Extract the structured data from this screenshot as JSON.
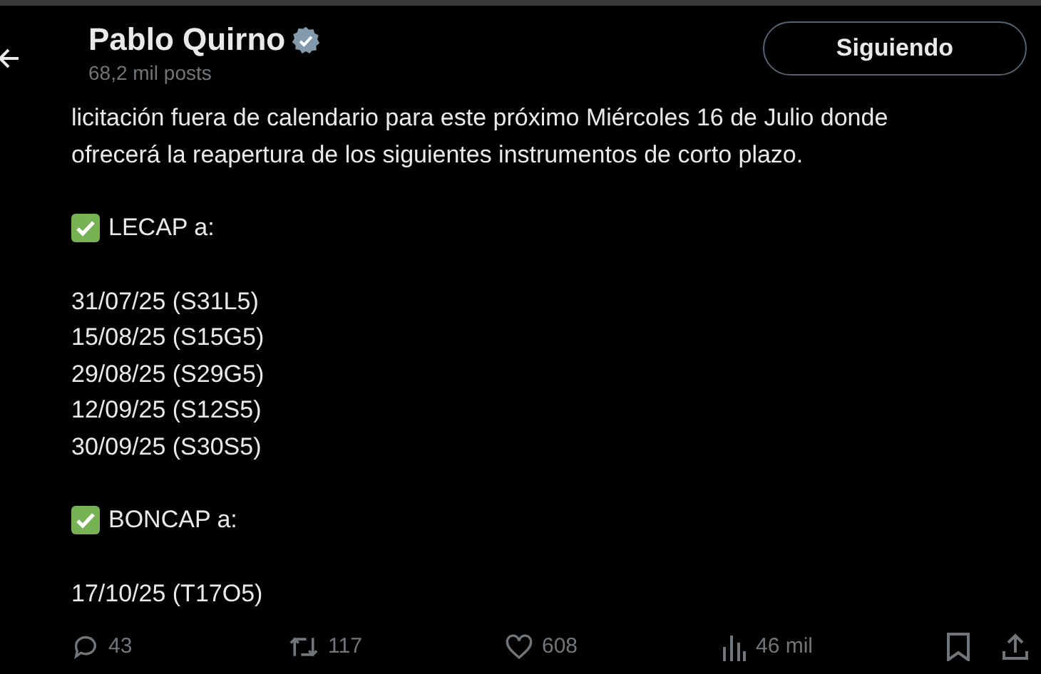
{
  "header": {
    "name": "Pablo Quirno",
    "verified": true,
    "posts": "68,2 mil posts",
    "follow_button": "Siguiendo"
  },
  "paragraphs": [
    [
      {
        "kind": "text",
        "text": "licitación fuera de calendario para este próximo Miércoles 16 de Julio donde"
      },
      {
        "kind": "text",
        "text": "ofrecerá la reapertura de los siguientes instrumentos de corto plazo."
      }
    ],
    [
      {
        "kind": "check",
        "text": "LECAP a:"
      }
    ],
    [
      {
        "kind": "text",
        "text": "31/07/25 (S31L5)"
      },
      {
        "kind": "text",
        "text": "15/08/25 (S15G5)"
      },
      {
        "kind": "text",
        "text": "29/08/25 (S29G5)"
      },
      {
        "kind": "text",
        "text": "12/09/25 (S12S5)"
      },
      {
        "kind": "text",
        "text": "30/09/25 (S30S5)"
      }
    ],
    [
      {
        "kind": "check",
        "text": "BONCAP a:"
      }
    ],
    [
      {
        "kind": "text",
        "text": "17/10/25 (T17O5)"
      }
    ]
  ],
  "actions": [
    {
      "kind": "reply",
      "count": "43"
    },
    {
      "kind": "repost",
      "count": "117"
    },
    {
      "kind": "like",
      "count": "608"
    },
    {
      "kind": "views",
      "count": "46 mil"
    }
  ]
}
